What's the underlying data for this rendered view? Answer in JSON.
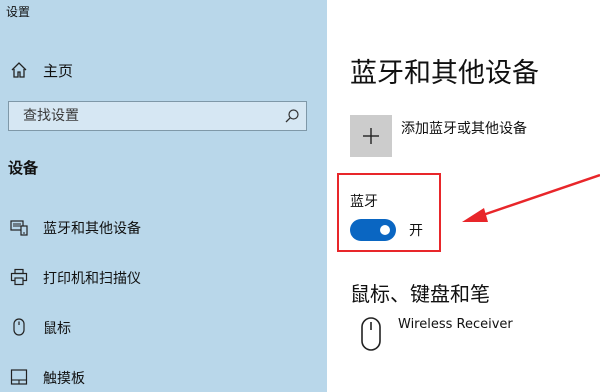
{
  "window": {
    "title": "设置"
  },
  "sidebar": {
    "home_label": "主页",
    "search_placeholder": "查找设置",
    "section_title": "设备",
    "items": [
      {
        "label": "蓝牙和其他设备",
        "icon": "devices-icon"
      },
      {
        "label": "打印机和扫描仪",
        "icon": "printer-icon"
      },
      {
        "label": "鼠标",
        "icon": "mouse-icon"
      },
      {
        "label": "触摸板",
        "icon": "touchpad-icon"
      }
    ]
  },
  "main": {
    "page_title": "蓝牙和其他设备",
    "add_device_label": "添加蓝牙或其他设备",
    "bluetooth": {
      "label": "蓝牙",
      "state": "开",
      "on": true
    },
    "mouse_section_title": "鼠标、键盘和笔",
    "device": {
      "name": "Wireless Receiver",
      "icon": "mouse-icon"
    }
  },
  "colors": {
    "sidebar_bg": "#b9d7ea",
    "accent": "#0a66c2",
    "highlight": "#e8262a"
  }
}
